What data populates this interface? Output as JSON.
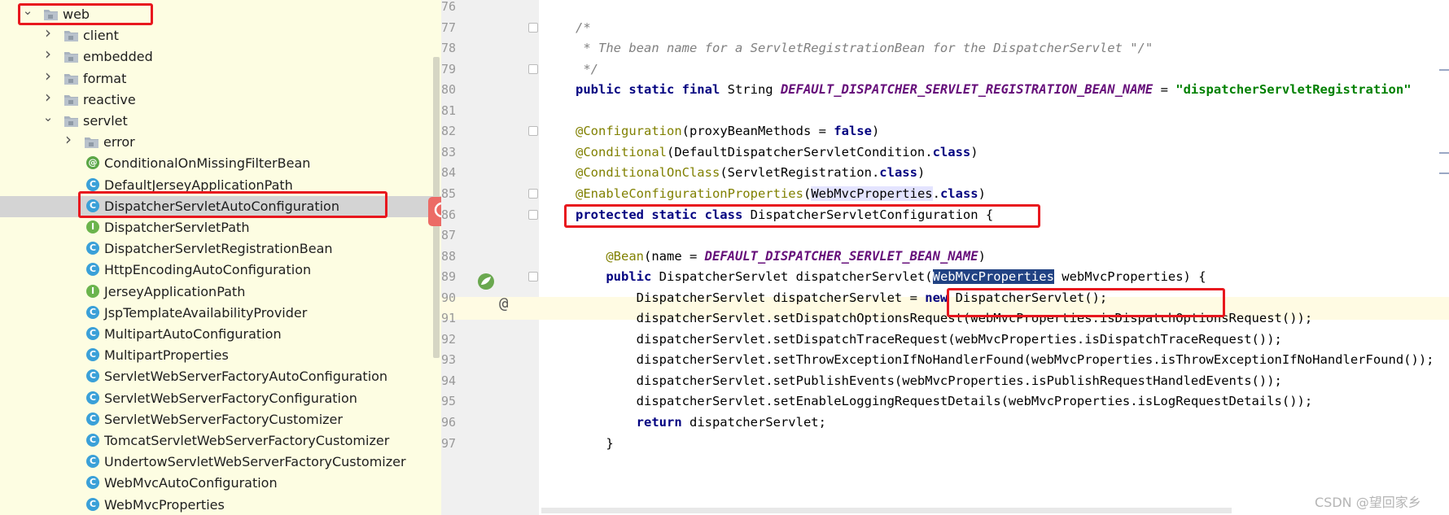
{
  "tree": {
    "rows": [
      {
        "label": "web",
        "type": "folder",
        "depth": 0,
        "expanded": true
      },
      {
        "label": "client",
        "type": "folder",
        "depth": 1,
        "expanded": false
      },
      {
        "label": "embedded",
        "type": "folder",
        "depth": 1,
        "expanded": false
      },
      {
        "label": "format",
        "type": "folder",
        "depth": 1,
        "expanded": false
      },
      {
        "label": "reactive",
        "type": "folder",
        "depth": 1,
        "expanded": false
      },
      {
        "label": "servlet",
        "type": "folder",
        "depth": 1,
        "expanded": true
      },
      {
        "label": "error",
        "type": "folder",
        "depth": 2,
        "expanded": false
      },
      {
        "label": "ConditionalOnMissingFilterBean",
        "type": "annotation",
        "depth": 2
      },
      {
        "label": "DefaultJerseyApplicationPath",
        "type": "class",
        "depth": 2
      },
      {
        "label": "DispatcherServletAutoConfiguration",
        "type": "class",
        "depth": 2,
        "selected": true
      },
      {
        "label": "DispatcherServletPath",
        "type": "interface",
        "depth": 2
      },
      {
        "label": "DispatcherServletRegistrationBean",
        "type": "class",
        "depth": 2
      },
      {
        "label": "HttpEncodingAutoConfiguration",
        "type": "class",
        "depth": 2
      },
      {
        "label": "JerseyApplicationPath",
        "type": "interface",
        "depth": 2
      },
      {
        "label": "JspTemplateAvailabilityProvider",
        "type": "class",
        "depth": 2
      },
      {
        "label": "MultipartAutoConfiguration",
        "type": "class",
        "depth": 2
      },
      {
        "label": "MultipartProperties",
        "type": "class",
        "depth": 2
      },
      {
        "label": "ServletWebServerFactoryAutoConfiguration",
        "type": "class",
        "depth": 2
      },
      {
        "label": "ServletWebServerFactoryConfiguration",
        "type": "class",
        "depth": 2
      },
      {
        "label": "ServletWebServerFactoryCustomizer",
        "type": "class",
        "depth": 2
      },
      {
        "label": "TomcatServletWebServerFactoryCustomizer",
        "type": "class",
        "depth": 2
      },
      {
        "label": "UndertowServletWebServerFactoryCustomizer",
        "type": "class",
        "depth": 2
      },
      {
        "label": "WebMvcAutoConfiguration",
        "type": "class",
        "depth": 2
      },
      {
        "label": "WebMvcProperties",
        "type": "class",
        "depth": 2
      }
    ],
    "icon_letters": {
      "class": "C",
      "interface": "I",
      "annotation": "@"
    }
  },
  "editor": {
    "first_line_number": 76,
    "lines": [
      {
        "n": "76",
        "code": []
      },
      {
        "n": "77",
        "code": [
          [
            "cm",
            "/*"
          ]
        ]
      },
      {
        "n": "78",
        "code": [
          [
            "cm",
            " * The bean name for a ServletRegistrationBean for the DispatcherServlet \"/\""
          ]
        ]
      },
      {
        "n": "79",
        "code": [
          [
            "cm",
            " */"
          ]
        ]
      },
      {
        "n": "80",
        "code": [
          [
            "kw",
            "public static final "
          ],
          [
            "",
            "String "
          ],
          [
            "cst",
            "DEFAULT_DISPATCHER_SERVLET_REGISTRATION_BEAN_NAME"
          ],
          [
            "",
            " = "
          ],
          [
            "str",
            "\"dispatcherServletRegistration\""
          ]
        ]
      },
      {
        "n": "81",
        "code": []
      },
      {
        "n": "82",
        "code": [
          [
            "an",
            "@Configuration"
          ],
          [
            "",
            "(proxyBeanMethods = "
          ],
          [
            "kw",
            "false"
          ],
          [
            "",
            ")"
          ]
        ]
      },
      {
        "n": "83",
        "code": [
          [
            "an",
            "@Conditional"
          ],
          [
            "",
            "(DefaultDispatcherServletCondition."
          ],
          [
            "kw",
            "class"
          ],
          [
            "",
            ")"
          ]
        ]
      },
      {
        "n": "84",
        "code": [
          [
            "an",
            "@ConditionalOnClass"
          ],
          [
            "",
            "(ServletRegistration."
          ],
          [
            "kw",
            "class"
          ],
          [
            "",
            ")"
          ]
        ]
      },
      {
        "n": "85",
        "code": [
          [
            "an",
            "@EnableConfigurationProperties"
          ],
          [
            "",
            "("
          ],
          [
            "hl",
            "WebMvcProperties"
          ],
          [
            "",
            "."
          ],
          [
            "kw",
            "class"
          ],
          [
            "",
            ")"
          ]
        ]
      },
      {
        "n": "86",
        "code": [
          [
            "kw",
            "protected static class "
          ],
          [
            "",
            "DispatcherServletConfiguration {"
          ]
        ]
      },
      {
        "n": "87",
        "code": []
      },
      {
        "n": "88",
        "code": [
          [
            "",
            "    "
          ],
          [
            "an",
            "@Bean"
          ],
          [
            "",
            "(name = "
          ],
          [
            "cst",
            "DEFAULT_DISPATCHER_SERVLET_BEAN_NAME"
          ],
          [
            "",
            ")"
          ]
        ]
      },
      {
        "n": "89",
        "code": [
          [
            "",
            "    "
          ],
          [
            "kw",
            "public "
          ],
          [
            "",
            "DispatcherServlet dispatcherServlet("
          ],
          [
            "hl-sel",
            "WebMvcProperties"
          ],
          [
            "",
            " webMvcProperties) {"
          ]
        ]
      },
      {
        "n": "90",
        "code": [
          [
            "",
            "        DispatcherServlet dispatcherServlet = "
          ],
          [
            "kw",
            "new "
          ],
          [
            "",
            "DispatcherServlet();"
          ]
        ]
      },
      {
        "n": "91",
        "code": [
          [
            "",
            "        dispatcherServlet.setDispatchOptionsRequest(webMvcProperties.isDispatchOptionsRequest());"
          ]
        ]
      },
      {
        "n": "92",
        "code": [
          [
            "",
            "        dispatcherServlet.setDispatchTraceRequest(webMvcProperties.isDispatchTraceRequest());"
          ]
        ]
      },
      {
        "n": "93",
        "code": [
          [
            "",
            "        dispatcherServlet.setThrowExceptionIfNoHandlerFound(webMvcProperties.isThrowExceptionIfNoHandlerFound());"
          ]
        ]
      },
      {
        "n": "94",
        "code": [
          [
            "",
            "        dispatcherServlet.setPublishEvents(webMvcProperties.isPublishRequestHandledEvents());"
          ]
        ]
      },
      {
        "n": "95",
        "code": [
          [
            "",
            "        dispatcherServlet.setEnableLoggingRequestDetails(webMvcProperties.isLogRequestDetails());"
          ]
        ]
      },
      {
        "n": "96",
        "code": [
          [
            "",
            "        "
          ],
          [
            "kw",
            "return "
          ],
          [
            "",
            "dispatcherServlet;"
          ]
        ]
      },
      {
        "n": "97",
        "code": [
          [
            "",
            "    }"
          ]
        ]
      }
    ],
    "gutter_marks": {
      "88": "bean-icon",
      "89": "@"
    }
  },
  "watermark": "CSDN @望回家乡",
  "colors": {
    "highlight_box": "#e8171e",
    "tree_bg": "#fdfde2",
    "selection": "#214283"
  }
}
